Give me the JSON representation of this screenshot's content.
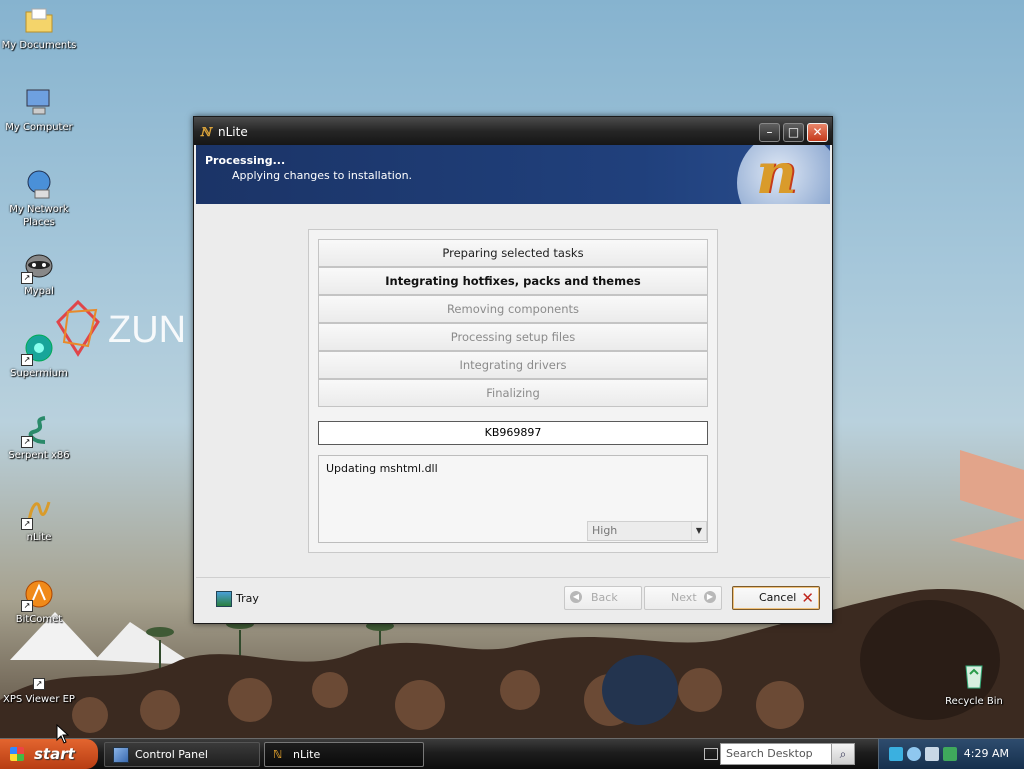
{
  "desktop": {
    "icons": [
      {
        "label": "My Documents"
      },
      {
        "label": "My Computer"
      },
      {
        "label": "My Network Places"
      },
      {
        "label": "Mypal"
      },
      {
        "label": "Supermium"
      },
      {
        "label": "Serpent x86"
      },
      {
        "label": "nLite"
      },
      {
        "label": "BitComet"
      },
      {
        "label": "XPS Viewer EP"
      },
      {
        "label": "Recycle Bin"
      }
    ],
    "wallpaper_logo": "ZUN"
  },
  "window": {
    "title": "nLite",
    "header": {
      "title": "Processing...",
      "subtitle": "Applying changes to installation."
    },
    "tasks": [
      {
        "label": "Preparing selected tasks",
        "state": "done"
      },
      {
        "label": "Integrating hotfixes, packs and themes",
        "state": "active"
      },
      {
        "label": "Removing components",
        "state": "pending"
      },
      {
        "label": "Processing setup files",
        "state": "pending"
      },
      {
        "label": "Integrating drivers",
        "state": "pending"
      },
      {
        "label": "Finalizing",
        "state": "pending"
      }
    ],
    "current_item": "KB969897",
    "log_text": "Updating mshtml.dll",
    "priority": {
      "selected": "High"
    },
    "footer": {
      "tray_label": "Tray",
      "back_label": "Back",
      "next_label": "Next",
      "cancel_label": "Cancel"
    }
  },
  "taskbar": {
    "start_label": "start",
    "items": [
      {
        "label": "Control Panel"
      },
      {
        "label": "nLite"
      }
    ],
    "search_placeholder": "Search Desktop",
    "clock": "4:29 AM"
  },
  "colors": {
    "header_blue": "#20407c",
    "cancel_x": "#c0261d",
    "start_orange": "#d0511f"
  }
}
